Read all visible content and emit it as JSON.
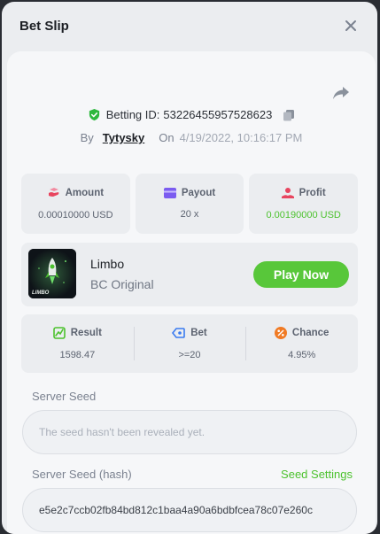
{
  "modal": {
    "title": "Bet Slip"
  },
  "bet": {
    "id_label": "Betting ID:",
    "id_value": "53226455957528623",
    "by_label": "By",
    "user": "Tytysky",
    "on_label": "On",
    "datetime": "4/19/2022, 10:16:17 PM"
  },
  "summary": {
    "amount": {
      "label": "Amount",
      "value": "0.00010000 USD"
    },
    "payout": {
      "label": "Payout",
      "value": "20 x"
    },
    "profit": {
      "label": "Profit",
      "value": "0.00190000 USD"
    }
  },
  "game": {
    "name": "Limbo",
    "provider": "BC Original",
    "play_label": "Play Now",
    "thumb_text": "LIMBO"
  },
  "result": {
    "result": {
      "label": "Result",
      "value": "1598.47"
    },
    "bet": {
      "label": "Bet",
      "value": ">=20"
    },
    "chance": {
      "label": "Chance",
      "value": "4.95%"
    }
  },
  "seeds": {
    "server_seed_label": "Server Seed",
    "server_seed_placeholder": "The seed hasn't been revealed yet.",
    "hash_label": "Server Seed (hash)",
    "seed_settings_label": "Seed Settings",
    "hash_value": "e5e2c7ccb02fb84bd812c1baa4a90a6bdbfcea78c07e260c"
  },
  "colors": {
    "accent_green": "#58c73a",
    "profit_green": "#4cc22e",
    "payout_purple": "#7b5cf0",
    "amount_pink": "#e8455f",
    "chance_orange": "#f07a24",
    "bet_blue": "#3a7bf0"
  }
}
